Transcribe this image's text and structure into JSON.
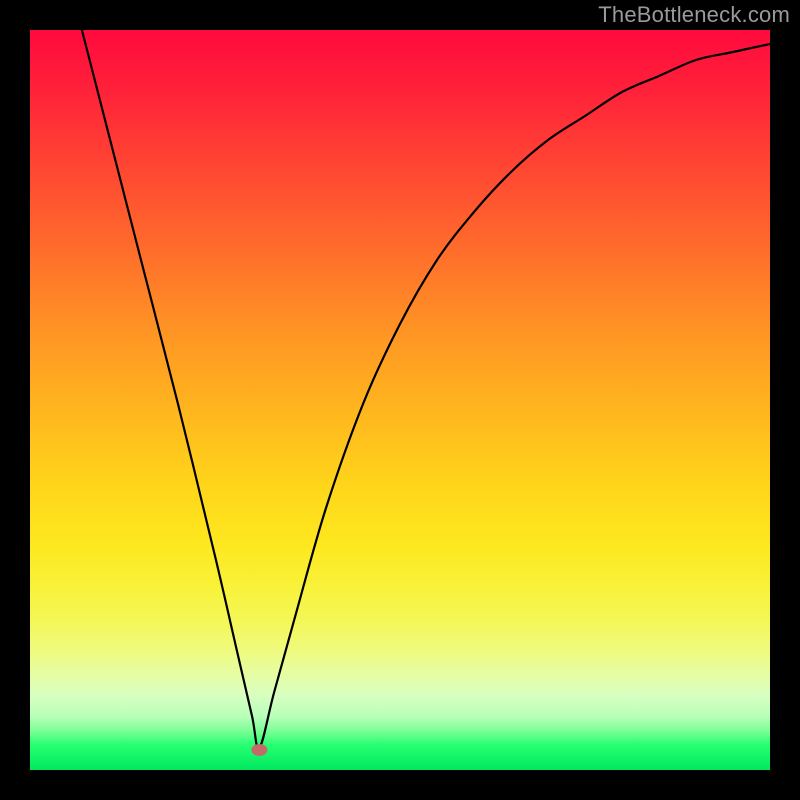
{
  "watermark": "TheBottleneck.com",
  "colors": {
    "frame": "#000000",
    "gradient_top": "#ff0a3c",
    "gradient_bottom": "#00e85f",
    "curve": "#000000",
    "dot": "#c46a68"
  },
  "chart_data": {
    "type": "line",
    "title": "",
    "xlabel": "",
    "ylabel": "",
    "xlim": [
      0,
      100
    ],
    "ylim": [
      0,
      100
    ],
    "optimum_x": 31,
    "optimum_y": 0,
    "series": [
      {
        "name": "bottleneck-curve",
        "x": [
          0,
          5,
          10,
          15,
          20,
          25,
          28,
          30,
          31,
          33,
          36,
          40,
          45,
          50,
          55,
          60,
          65,
          70,
          75,
          80,
          85,
          90,
          95,
          100
        ],
        "y": [
          115,
          97,
          79,
          61,
          43,
          24,
          12,
          4,
          0,
          7,
          17,
          30,
          43,
          53,
          61,
          67,
          72,
          76,
          79,
          82,
          84,
          86,
          87,
          88
        ]
      }
    ],
    "annotation_points": [
      {
        "name": "minimum-dot",
        "x": 31,
        "y": 0
      }
    ]
  }
}
